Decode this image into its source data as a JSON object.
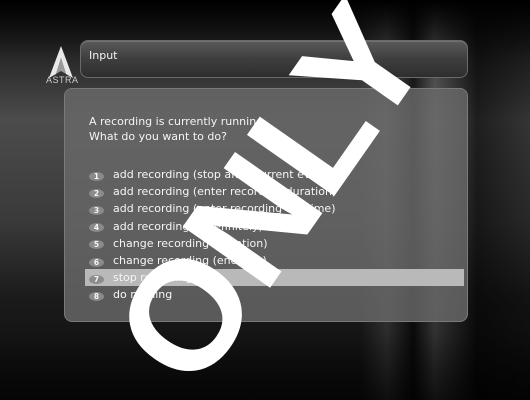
{
  "logo": {
    "brand": "ASTRA"
  },
  "header": {
    "title": "Input"
  },
  "dialog": {
    "message_line1": "A recording is currently running.",
    "message_line2": "What do you want to do?",
    "options": [
      {
        "num": "1",
        "label": "add recording (stop after current event)"
      },
      {
        "num": "2",
        "label": "add recording (enter recording duration)"
      },
      {
        "num": "3",
        "label": "add recording (enter recording endtime)"
      },
      {
        "num": "4",
        "label": "add recording (indefinitely)"
      },
      {
        "num": "5",
        "label": "change recording (duration)"
      },
      {
        "num": "6",
        "label": "change recording (endtime)"
      },
      {
        "num": "7",
        "label": "stop recording"
      },
      {
        "num": "8",
        "label": "do nothing"
      }
    ],
    "selected_option": "7"
  },
  "watermark": {
    "text": "ONLY"
  },
  "colors": {
    "highlight": "#b9b9b9",
    "panel": "#696969"
  }
}
